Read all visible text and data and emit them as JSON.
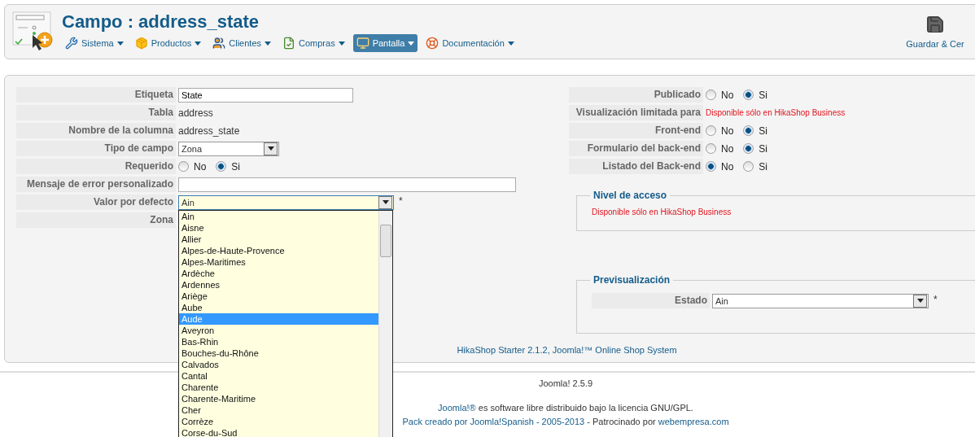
{
  "header": {
    "title": "Campo : address_state",
    "save": "Guardar & Cer",
    "menu": [
      {
        "kind": "wrench",
        "label": "Sistema",
        "selected": false
      },
      {
        "kind": "box",
        "label": "Productos",
        "selected": false
      },
      {
        "kind": "users",
        "label": "Clientes",
        "selected": false
      },
      {
        "kind": "doc",
        "label": "Compras",
        "selected": false
      },
      {
        "kind": "screen",
        "label": "Pantalla",
        "selected": true
      },
      {
        "kind": "lifebuoy",
        "label": "Documentación",
        "selected": false
      }
    ]
  },
  "form_left": [
    {
      "kind": "input",
      "label": "Etiqueta",
      "value": "State"
    },
    {
      "kind": "text",
      "label": "Tabla",
      "value": "address"
    },
    {
      "kind": "text",
      "label": "Nombre de la columna",
      "value": "address_state"
    },
    {
      "kind": "select",
      "label": "Tipo de campo",
      "value": "Zona"
    },
    {
      "kind": "radio",
      "label": "Requerido",
      "options": [
        {
          "label": "No",
          "selected": false
        },
        {
          "label": "Si",
          "selected": true
        }
      ]
    },
    {
      "kind": "input",
      "label": "Mensaje de error personalizado"
    },
    {
      "kind": "select",
      "label": "Valor por defecto",
      "value": "Ain",
      "required": "*",
      "open": true
    },
    {
      "kind": "empty",
      "label": "Zona"
    }
  ],
  "dropdown": {
    "options": [
      {
        "label": "Ain",
        "selected": false
      },
      {
        "label": "Aisne",
        "selected": false
      },
      {
        "label": "Allier",
        "selected": false
      },
      {
        "label": "Alpes-de-Haute-Provence",
        "selected": false
      },
      {
        "label": "Alpes-Maritimes",
        "selected": false
      },
      {
        "label": "Ardèche",
        "selected": false
      },
      {
        "label": "Ardennes",
        "selected": false
      },
      {
        "label": "Ariège",
        "selected": false
      },
      {
        "label": "Aube",
        "selected": false
      },
      {
        "label": "Aude",
        "selected": true
      },
      {
        "label": "Aveyron",
        "selected": false
      },
      {
        "label": "Bas-Rhin",
        "selected": false
      },
      {
        "label": "Bouches-du-Rhône",
        "selected": false
      },
      {
        "label": "Calvados",
        "selected": false
      },
      {
        "label": "Cantal",
        "selected": false
      },
      {
        "label": "Charente",
        "selected": false
      },
      {
        "label": "Charente-Maritime",
        "selected": false
      },
      {
        "label": "Cher",
        "selected": false
      },
      {
        "label": "Corrèze",
        "selected": false
      },
      {
        "label": "Corse-du-Sud",
        "selected": false
      }
    ]
  },
  "form_right": [
    {
      "kind": "radio",
      "label": "Publicado",
      "options": [
        {
          "label": "No",
          "selected": false
        },
        {
          "label": "Si",
          "selected": true
        }
      ]
    },
    {
      "kind": "note",
      "label": "Visualización limitada para",
      "value": "Disponible sólo en HikaShop Business"
    },
    {
      "kind": "radio",
      "label": "Front-end",
      "options": [
        {
          "label": "No",
          "selected": false
        },
        {
          "label": "Si",
          "selected": true
        }
      ]
    },
    {
      "kind": "radio",
      "label": "Formulario del back-end",
      "options": [
        {
          "label": "No",
          "selected": false
        },
        {
          "label": "Si",
          "selected": true
        }
      ]
    },
    {
      "kind": "radio",
      "label": "Listado del Back-end",
      "options": [
        {
          "label": "No",
          "selected": true
        },
        {
          "label": "Si",
          "selected": false
        }
      ]
    }
  ],
  "access": {
    "title": "Nivel de acceso",
    "note": "Disponible sólo en HikaShop Business"
  },
  "preview": {
    "title": "Previsualización",
    "label": "Estado",
    "value": "Ain",
    "required": "*"
  },
  "panel_footer": "HikaShop Starter 2.1.2, Joomla!™ Online Shop System",
  "footer": {
    "version": "Joomla! 2.5.9",
    "license": [
      {
        "text": "Joomla!®",
        "link": true
      },
      {
        "text": "es software libre distribuido bajo la licencia GNU/GPL.",
        "link": false
      }
    ],
    "pack": [
      {
        "text": "Pack creado por Joomla!Spanish - 2005-2013",
        "link": true
      },
      {
        "text": "- Patrocinado por",
        "link": false
      },
      {
        "text": "webempresa.com",
        "link": true
      }
    ]
  }
}
